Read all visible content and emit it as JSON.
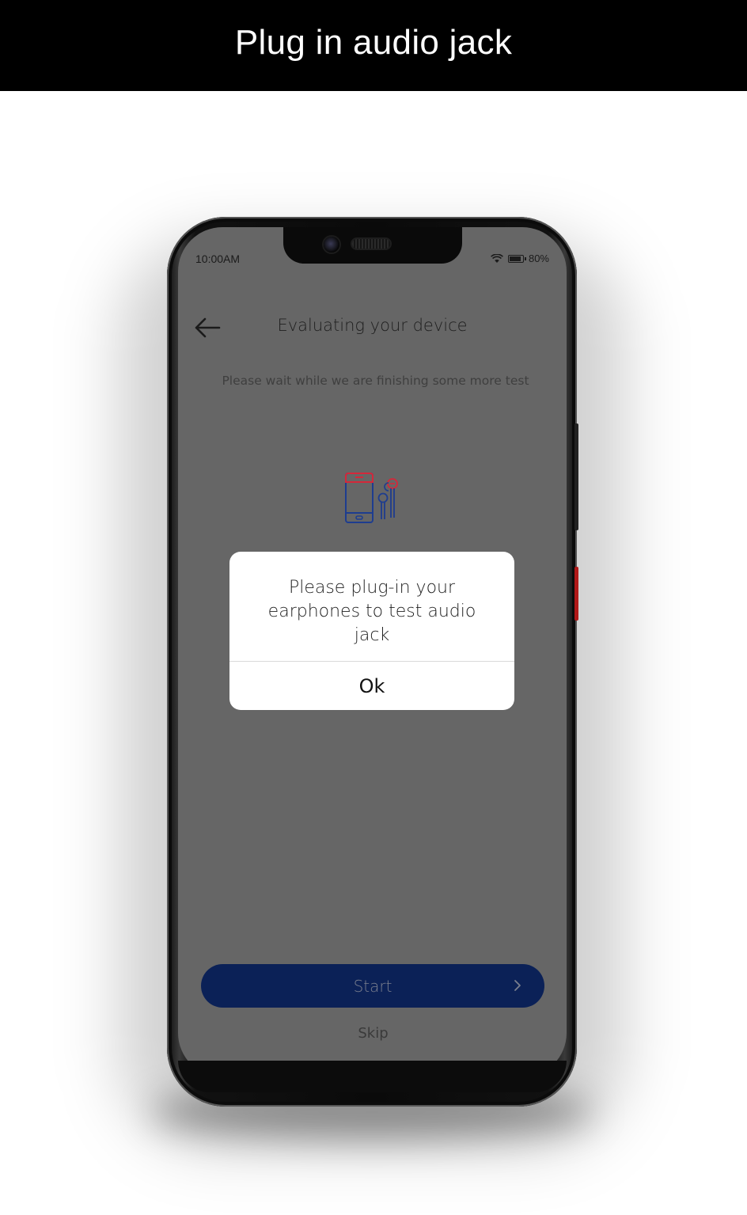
{
  "banner": {
    "title": "Plug in audio jack"
  },
  "status_bar": {
    "time": "10:00AM",
    "battery": "80%",
    "icons": [
      "wifi-icon",
      "battery-icon"
    ]
  },
  "header": {
    "back_icon": "arrow-left-icon",
    "title": "Evaluating your device"
  },
  "subtitle": "Please wait while we are finishing some more test",
  "illustration": {
    "icon": "phone-earphones-icon",
    "colors": {
      "accent_red": "#d4283a",
      "accent_blue": "#1e3d8f"
    }
  },
  "dialog": {
    "message": "Please plug-in your earphones to test audio jack",
    "ok_label": "Ok"
  },
  "footer": {
    "start_label": "Start",
    "start_icon": "chevron-right-icon",
    "skip_label": "Skip",
    "primary_color": "#0b2157"
  },
  "overlay_color": "#666666"
}
